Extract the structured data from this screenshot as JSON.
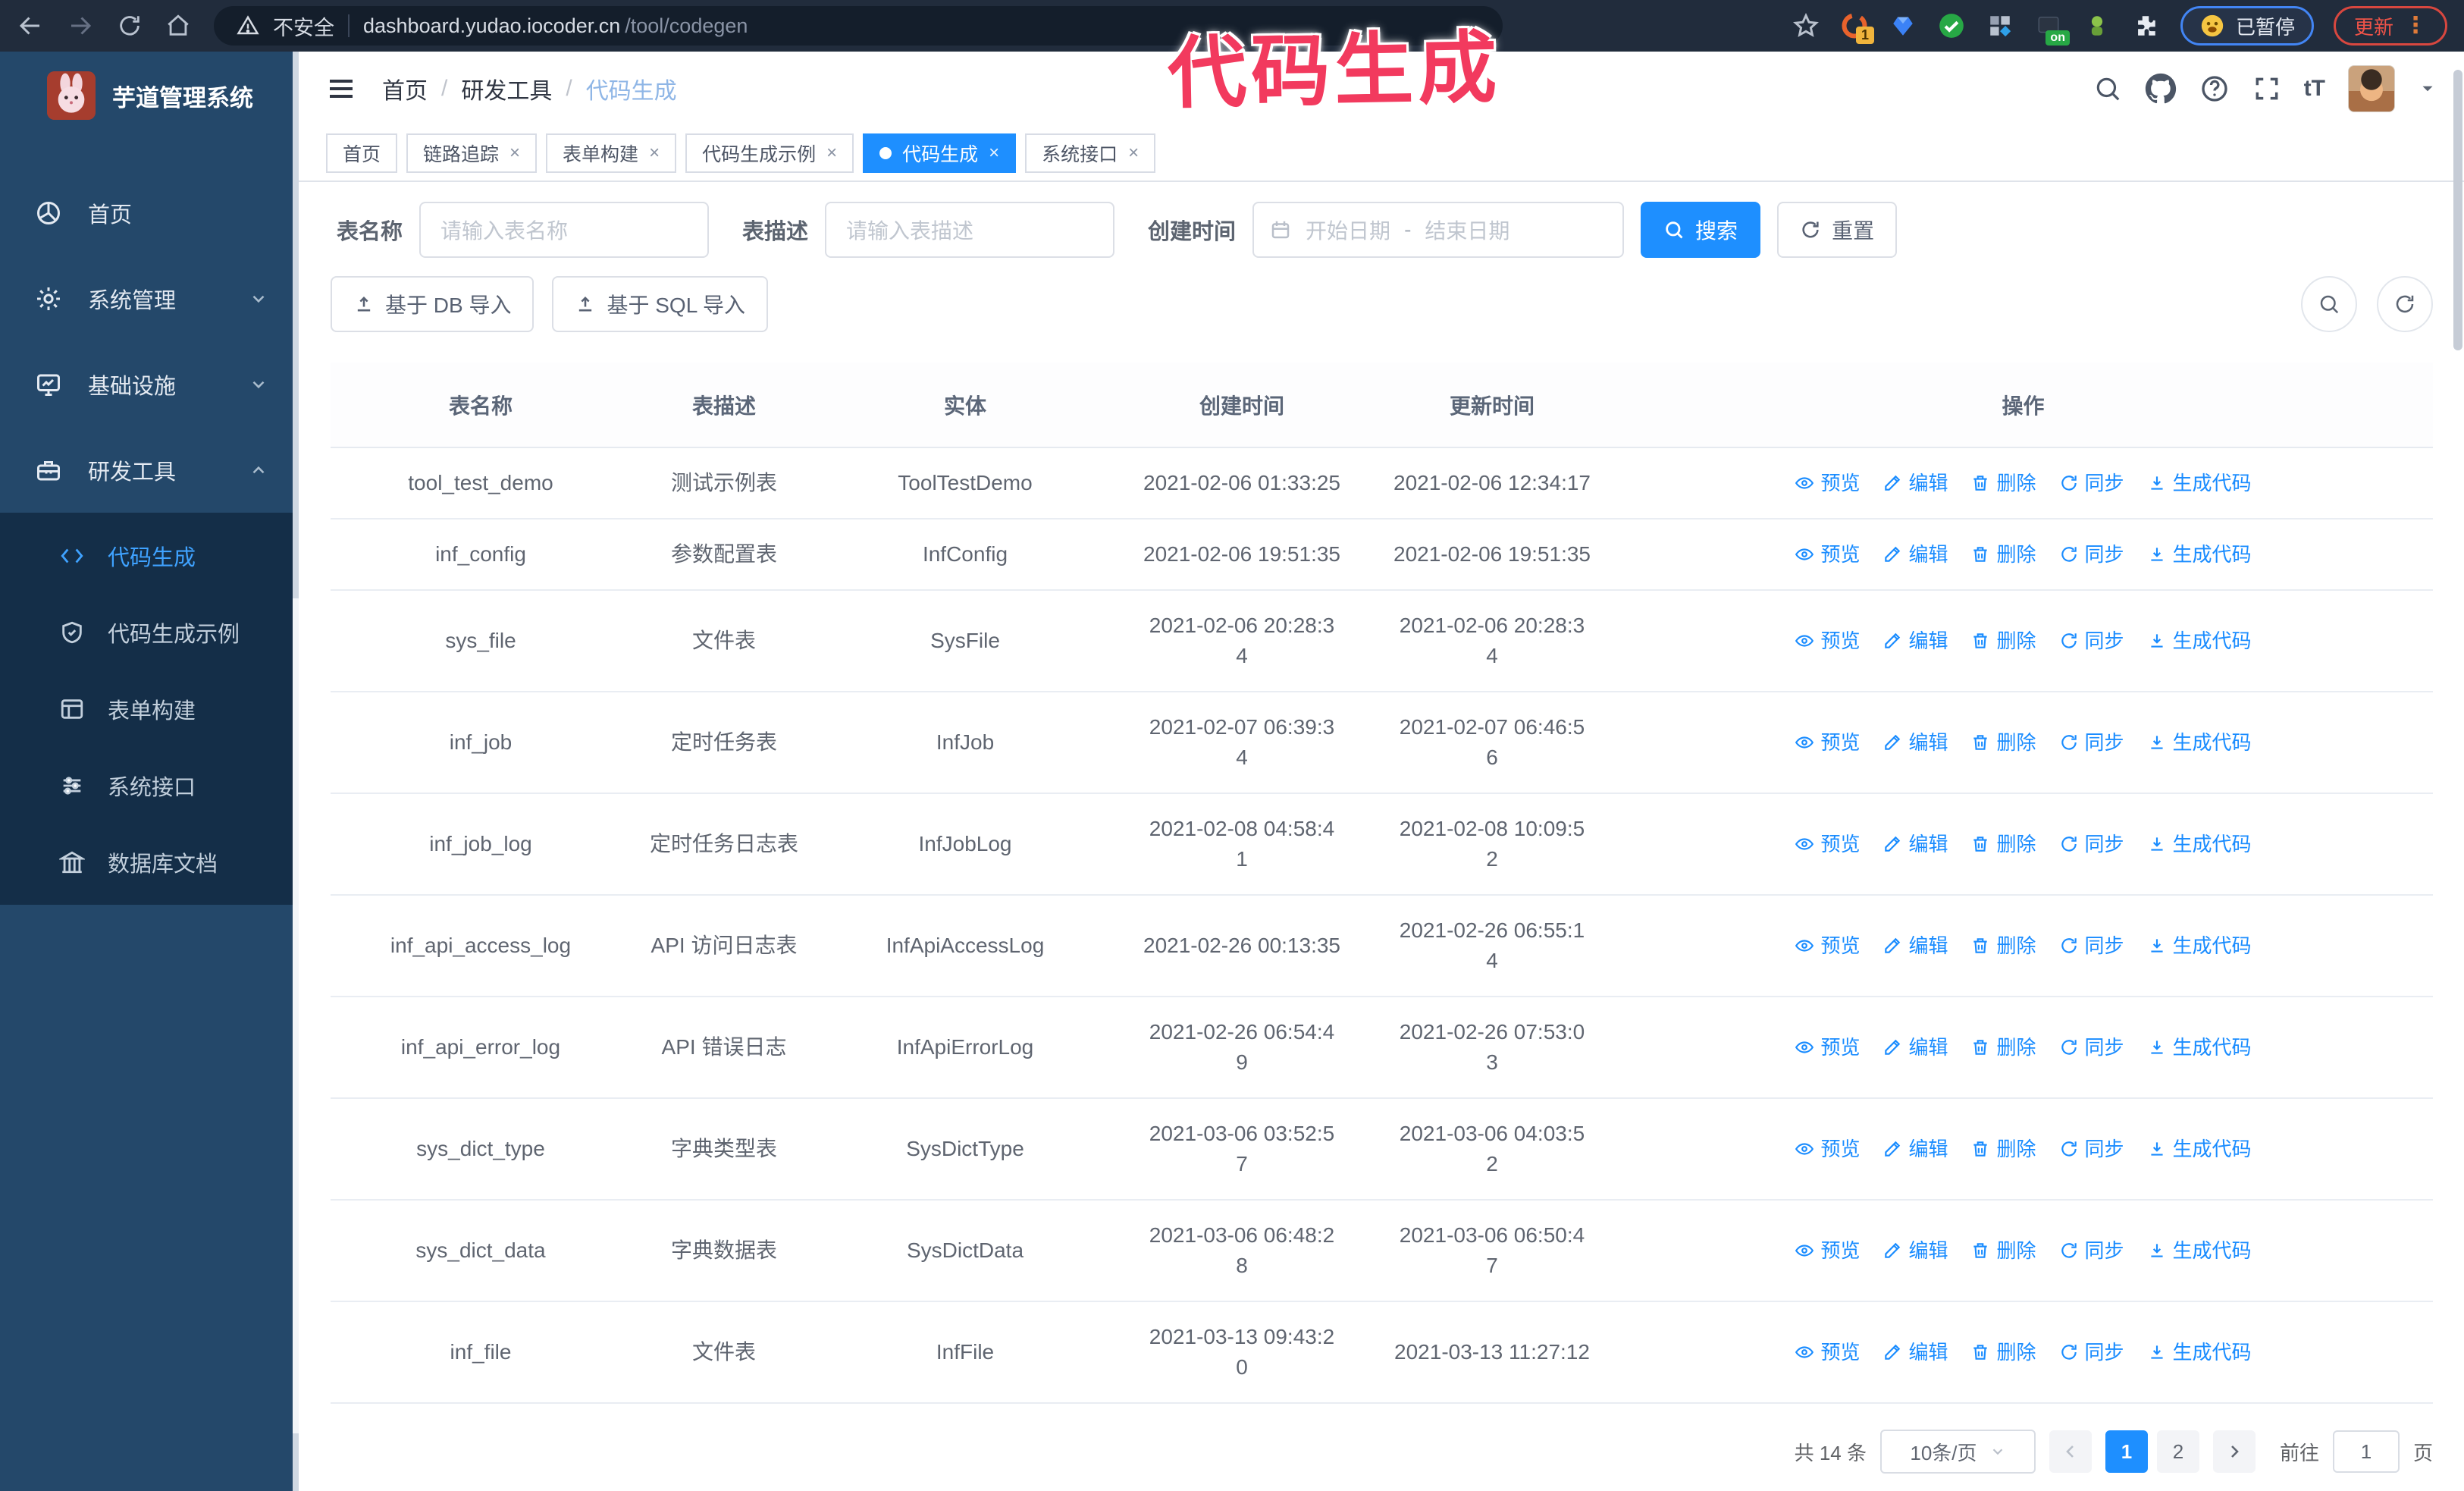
{
  "colors": {
    "accent": "#1e8fff",
    "sidebar": "#24486a",
    "submenu": "#142e48",
    "annotation": "#f23a5e",
    "link": "#1a8cff"
  },
  "annotation": {
    "text": "代码生成"
  },
  "browser": {
    "nav_icons": [
      "back-icon",
      "forward-icon",
      "reload-icon",
      "home-icon"
    ],
    "security_warning": "不安全",
    "url_domain": "dashboard.yudao.iocoder.cn",
    "url_path": "/tool/codegen",
    "extensions": [
      "bookmark-star-icon",
      "orange-extension-icon",
      "blue-gem-extension-icon",
      "green-check-extension-icon",
      "grid-extension-icon",
      "dark-on-extension-icon",
      "green-bot-extension-icon",
      "puzzle-extension-icon"
    ],
    "extension_badge_count": "1",
    "extension_badge_on": "on",
    "paused_badge": "已暂停",
    "update_button": "更新"
  },
  "sidebar": {
    "title": "芋道管理系统",
    "items": [
      {
        "label": "首页",
        "icon": "dashboard-icon",
        "chevron": ""
      },
      {
        "label": "系统管理",
        "icon": "gear-icon",
        "chevron": "down"
      },
      {
        "label": "基础设施",
        "icon": "monitor-icon",
        "chevron": "down"
      },
      {
        "label": "研发工具",
        "icon": "toolbox-icon",
        "chevron": "up"
      }
    ],
    "subitems": [
      {
        "label": "代码生成",
        "icon": "code-icon",
        "active": true
      },
      {
        "label": "代码生成示例",
        "icon": "shield-check-icon",
        "active": false
      },
      {
        "label": "表单构建",
        "icon": "form-icon",
        "active": false
      },
      {
        "label": "系统接口",
        "icon": "sliders-icon",
        "active": false
      },
      {
        "label": "数据库文档",
        "icon": "database-icon",
        "active": false
      }
    ]
  },
  "header": {
    "breadcrumb": [
      "首页",
      "研发工具",
      "代码生成"
    ],
    "right_icons": [
      "search-icon",
      "github-icon",
      "question-icon",
      "fullscreen-icon",
      "text-size-icon"
    ],
    "text_size_glyph": "tT"
  },
  "tabs": [
    {
      "label": "首页",
      "closable": false,
      "active": false
    },
    {
      "label": "链路追踪",
      "closable": true,
      "active": false
    },
    {
      "label": "表单构建",
      "closable": true,
      "active": false
    },
    {
      "label": "代码生成示例",
      "closable": true,
      "active": false
    },
    {
      "label": "代码生成",
      "closable": true,
      "active": true
    },
    {
      "label": "系统接口",
      "closable": true,
      "active": false
    }
  ],
  "filters": {
    "table_name_label": "表名称",
    "table_name_placeholder": "请输入表名称",
    "table_desc_label": "表描述",
    "table_desc_placeholder": "请输入表描述",
    "create_time_label": "创建时间",
    "date_start_placeholder": "开始日期",
    "date_separator": "-",
    "date_end_placeholder": "结束日期",
    "search_label": "搜索",
    "reset_label": "重置"
  },
  "toolbar": {
    "import_db_label": "基于 DB 导入",
    "import_sql_label": "基于 SQL 导入",
    "circle_icons": [
      "search-icon",
      "refresh-icon"
    ]
  },
  "table": {
    "columns": [
      "表名称",
      "表描述",
      "实体",
      "创建时间",
      "更新时间",
      "操作"
    ],
    "actions": [
      {
        "label": "预览",
        "icon": "eye-icon"
      },
      {
        "label": "编辑",
        "icon": "edit-icon"
      },
      {
        "label": "删除",
        "icon": "trash-icon"
      },
      {
        "label": "同步",
        "icon": "sync-icon"
      },
      {
        "label": "生成代码",
        "icon": "download-icon"
      }
    ],
    "rows": [
      {
        "name": "tool_test_demo",
        "desc": "测试示例表",
        "entity": "ToolTestDemo",
        "created": "2021-02-06 01:33:25",
        "updated": "2021-02-06 12:34:17"
      },
      {
        "name": "inf_config",
        "desc": "参数配置表",
        "entity": "InfConfig",
        "created": "2021-02-06 19:51:35",
        "updated": "2021-02-06 19:51:35"
      },
      {
        "name": "sys_file",
        "desc": "文件表",
        "entity": "SysFile",
        "created": "2021-02-06 20:28:3\n4",
        "updated": "2021-02-06 20:28:3\n4"
      },
      {
        "name": "inf_job",
        "desc": "定时任务表",
        "entity": "InfJob",
        "created": "2021-02-07 06:39:3\n4",
        "updated": "2021-02-07 06:46:5\n6"
      },
      {
        "name": "inf_job_log",
        "desc": "定时任务日志表",
        "entity": "InfJobLog",
        "created": "2021-02-08 04:58:4\n1",
        "updated": "2021-02-08 10:09:5\n2"
      },
      {
        "name": "inf_api_access_log",
        "desc": "API 访问日志表",
        "entity": "InfApiAccessLog",
        "created": "2021-02-26 00:13:35",
        "updated": "2021-02-26 06:55:1\n4"
      },
      {
        "name": "inf_api_error_log",
        "desc": "API 错误日志",
        "entity": "InfApiErrorLog",
        "created": "2021-02-26 06:54:4\n9",
        "updated": "2021-02-26 07:53:0\n3"
      },
      {
        "name": "sys_dict_type",
        "desc": "字典类型表",
        "entity": "SysDictType",
        "created": "2021-03-06 03:52:5\n7",
        "updated": "2021-03-06 04:03:5\n2"
      },
      {
        "name": "sys_dict_data",
        "desc": "字典数据表",
        "entity": "SysDictData",
        "created": "2021-03-06 06:48:2\n8",
        "updated": "2021-03-06 06:50:4\n7"
      },
      {
        "name": "inf_file",
        "desc": "文件表",
        "entity": "InfFile",
        "created": "2021-03-13 09:43:2\n0",
        "updated": "2021-03-13 11:27:12"
      }
    ]
  },
  "pagination": {
    "total": "共 14 条",
    "page_size": "10条/页",
    "pages": [
      "1",
      "2"
    ],
    "current": "1",
    "jump_prefix": "前往",
    "jump_value": "1",
    "jump_suffix": "页"
  }
}
